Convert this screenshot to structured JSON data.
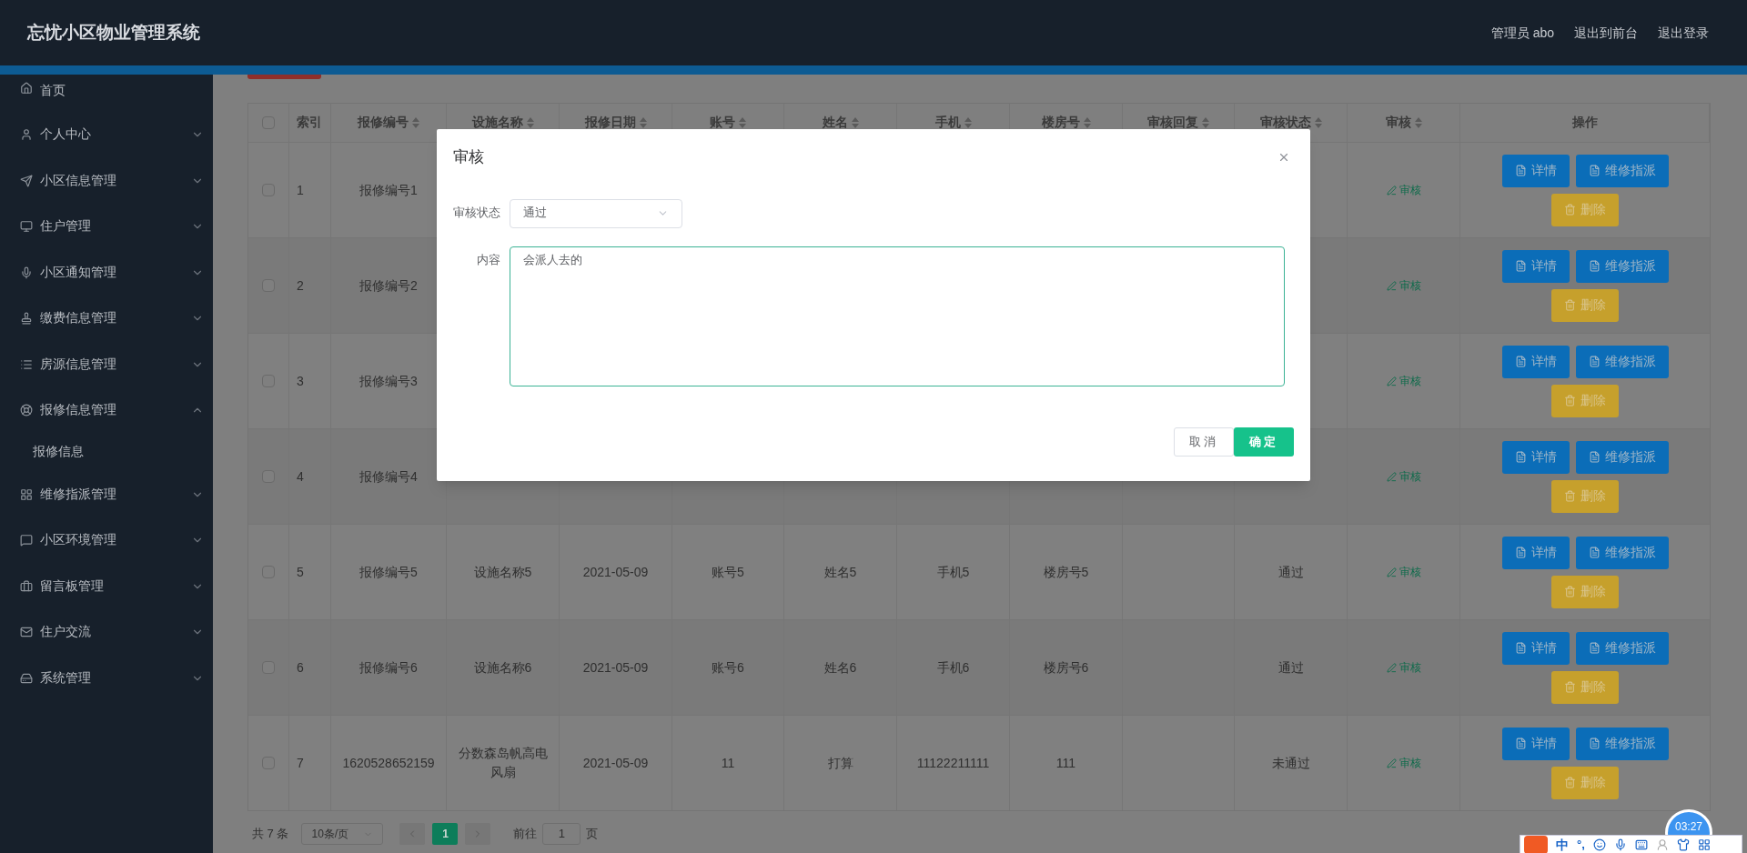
{
  "header": {
    "title": "忘忧小区物业管理系统",
    "links": [
      "管理员 abo",
      "退出到前台",
      "退出登录"
    ]
  },
  "sidebar": {
    "items": [
      {
        "label": "首页",
        "has_children": false
      },
      {
        "label": "个人中心",
        "has_children": true,
        "expanded": false
      },
      {
        "label": "小区信息管理",
        "has_children": true,
        "expanded": false
      },
      {
        "label": "住户管理",
        "has_children": true,
        "expanded": false
      },
      {
        "label": "小区通知管理",
        "has_children": true,
        "expanded": false
      },
      {
        "label": "缴费信息管理",
        "has_children": true,
        "expanded": false
      },
      {
        "label": "房源信息管理",
        "has_children": true,
        "expanded": false
      },
      {
        "label": "报修信息管理",
        "has_children": true,
        "expanded": true,
        "children": [
          {
            "label": "报修信息"
          }
        ]
      },
      {
        "label": "维修指派管理",
        "has_children": true,
        "expanded": false
      },
      {
        "label": "小区环境管理",
        "has_children": true,
        "expanded": false
      },
      {
        "label": "留言板管理",
        "has_children": true,
        "expanded": false
      },
      {
        "label": "住户交流",
        "has_children": true,
        "expanded": false
      },
      {
        "label": "系统管理",
        "has_children": true,
        "expanded": false
      }
    ]
  },
  "table": {
    "header_checkbox": {
      "checked": false
    },
    "columns": [
      {
        "label": "索引",
        "sortable": false
      },
      {
        "label": "报修编号",
        "sortable": true
      },
      {
        "label": "设施名称",
        "sortable": true
      },
      {
        "label": "报修日期",
        "sortable": true
      },
      {
        "label": "账号",
        "sortable": true
      },
      {
        "label": "姓名",
        "sortable": true
      },
      {
        "label": "手机",
        "sortable": true
      },
      {
        "label": "楼房号",
        "sortable": true
      },
      {
        "label": "审核回复",
        "sortable": true
      },
      {
        "label": "审核状态",
        "sortable": true
      },
      {
        "label": "审核",
        "sortable": true
      },
      {
        "label": "操作",
        "sortable": false
      }
    ],
    "rows": [
      {
        "checked": false,
        "index": "1",
        "code": "报修编号1",
        "review": "审核",
        "detail": "详情",
        "dispatch": "维修指派",
        "delete": "删除"
      },
      {
        "checked": false,
        "index": "2",
        "code": "报修编号2",
        "review": "审核",
        "detail": "详情",
        "dispatch": "维修指派",
        "delete": "删除"
      },
      {
        "checked": false,
        "index": "3",
        "code": "报修编号3",
        "review": "审核",
        "detail": "详情",
        "dispatch": "维修指派",
        "delete": "删除"
      },
      {
        "checked": false,
        "index": "4",
        "code": "报修编号4",
        "review": "审核",
        "detail": "详情",
        "dispatch": "维修指派",
        "delete": "删除"
      },
      {
        "checked": false,
        "index": "5",
        "code": "报修编号5",
        "facility": "设施名称5",
        "date": "2021-05-09",
        "account": "账号5",
        "name": "姓名5",
        "phone": "手机5",
        "building": "楼房号5",
        "status": "通过",
        "review": "审核",
        "detail": "详情",
        "dispatch": "维修指派",
        "delete": "删除"
      },
      {
        "checked": false,
        "index": "6",
        "code": "报修编号6",
        "facility": "设施名称6",
        "date": "2021-05-09",
        "account": "账号6",
        "name": "姓名6",
        "phone": "手机6",
        "building": "楼房号6",
        "status": "通过",
        "review": "审核",
        "detail": "详情",
        "dispatch": "维修指派",
        "delete": "删除"
      },
      {
        "checked": false,
        "index": "7",
        "code": "1620528652159",
        "facility": "分数森岛帆高电风扇",
        "date": "2021-05-09",
        "account": "11",
        "name": "打算",
        "phone": "11122211111",
        "building": "111",
        "status": "未通过",
        "review": "审核",
        "detail": "详情",
        "dispatch": "维修指派",
        "delete": "删除"
      }
    ]
  },
  "pagination": {
    "total": "共 7 条",
    "page_size": "10条/页",
    "pages": [
      {
        "label": "1",
        "selected": true
      }
    ],
    "goto_label": "前往",
    "goto_value": "1",
    "goto_suffix": "页"
  },
  "dialog": {
    "title": "审核",
    "status_label": "审核状态",
    "status_value": "通过",
    "content_label": "内容",
    "content_value": "会派人去的",
    "buttons": [
      {
        "label": "取消",
        "kind": "cancel"
      },
      {
        "label": "确定",
        "kind": "primary"
      }
    ]
  },
  "ime_bar": {
    "mode": "中",
    "punct": "°,"
  },
  "timer": "03:27"
}
